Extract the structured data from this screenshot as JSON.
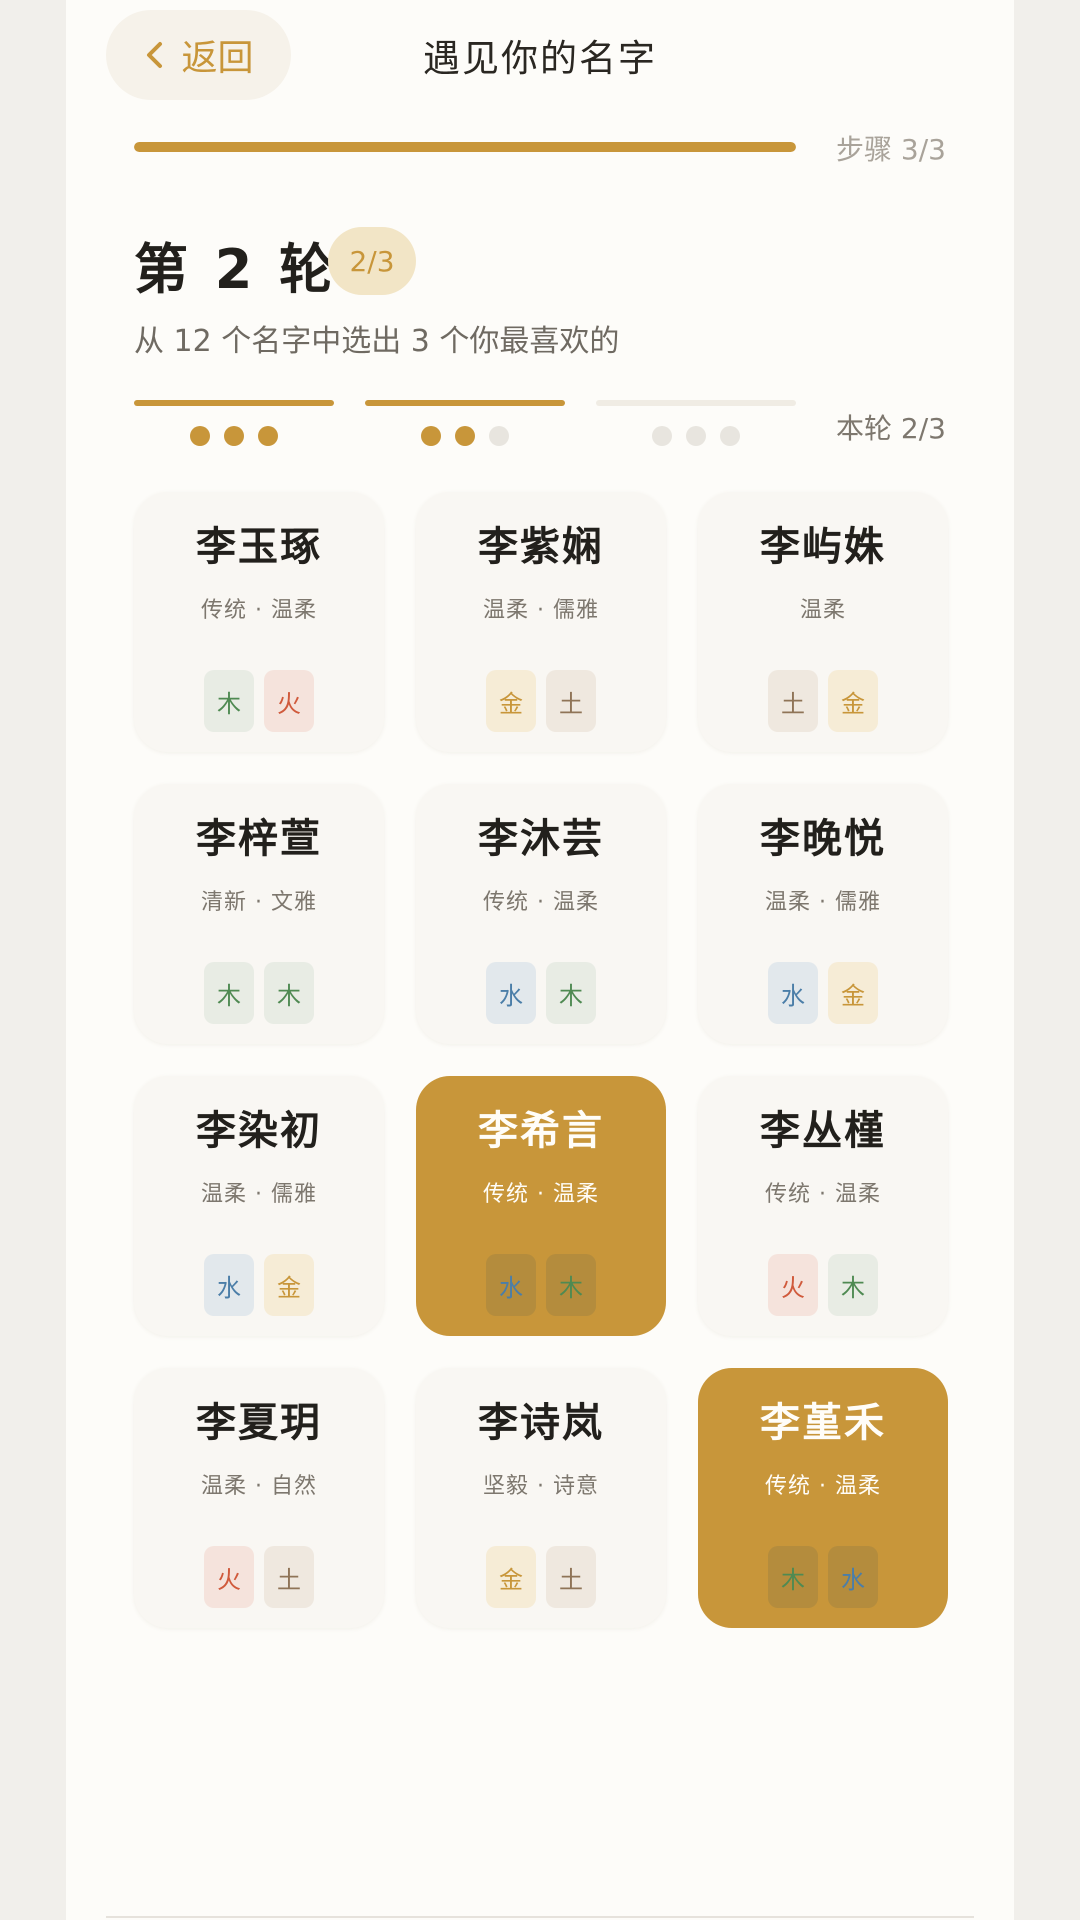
{
  "header": {
    "back_label": "返回",
    "title": "遇见你的名字"
  },
  "steps": {
    "label": "步骤 3/3",
    "progress": 1.0
  },
  "round": {
    "title": "第 2 轮",
    "badge": "2/3",
    "subtitle": "从 12 个名字中选出 3 个你最喜欢的",
    "progress_label": "本轮 2/3",
    "groups": [
      {
        "done": true,
        "dots": [
          true,
          true,
          true
        ]
      },
      {
        "done": true,
        "dots": [
          true,
          true,
          false
        ]
      },
      {
        "done": false,
        "dots": [
          false,
          false,
          false
        ]
      }
    ]
  },
  "names": [
    {
      "name": "李玉琢",
      "tags": "传统 · 温柔",
      "elements": [
        "木",
        "火"
      ],
      "selected": false
    },
    {
      "name": "李紫娴",
      "tags": "温柔 · 儒雅",
      "elements": [
        "金",
        "土"
      ],
      "selected": false
    },
    {
      "name": "李屿姝",
      "tags": "温柔",
      "elements": [
        "土",
        "金"
      ],
      "selected": false
    },
    {
      "name": "李梓萱",
      "tags": "清新 · 文雅",
      "elements": [
        "木",
        "木"
      ],
      "selected": false
    },
    {
      "name": "李沐芸",
      "tags": "传统 · 温柔",
      "elements": [
        "水",
        "木"
      ],
      "selected": false
    },
    {
      "name": "李晚悦",
      "tags": "温柔 · 儒雅",
      "elements": [
        "水",
        "金"
      ],
      "selected": false
    },
    {
      "name": "李染初",
      "tags": "温柔 · 儒雅",
      "elements": [
        "水",
        "金"
      ],
      "selected": false
    },
    {
      "name": "李希言",
      "tags": "传统 · 温柔",
      "elements": [
        "水",
        "木"
      ],
      "selected": true
    },
    {
      "name": "李丛槿",
      "tags": "传统 · 温柔",
      "elements": [
        "火",
        "木"
      ],
      "selected": false
    },
    {
      "name": "李夏玥",
      "tags": "温柔 · 自然",
      "elements": [
        "火",
        "土"
      ],
      "selected": false
    },
    {
      "name": "李诗岚",
      "tags": "坚毅 · 诗意",
      "elements": [
        "金",
        "土"
      ],
      "selected": false
    },
    {
      "name": "李堇禾",
      "tags": "传统 · 温柔",
      "elements": [
        "木",
        "水"
      ],
      "selected": true
    }
  ],
  "colors": {
    "accent": "#c8963a",
    "background": "#fdfcf9"
  },
  "icons": {
    "back": "chevron-left-icon"
  }
}
